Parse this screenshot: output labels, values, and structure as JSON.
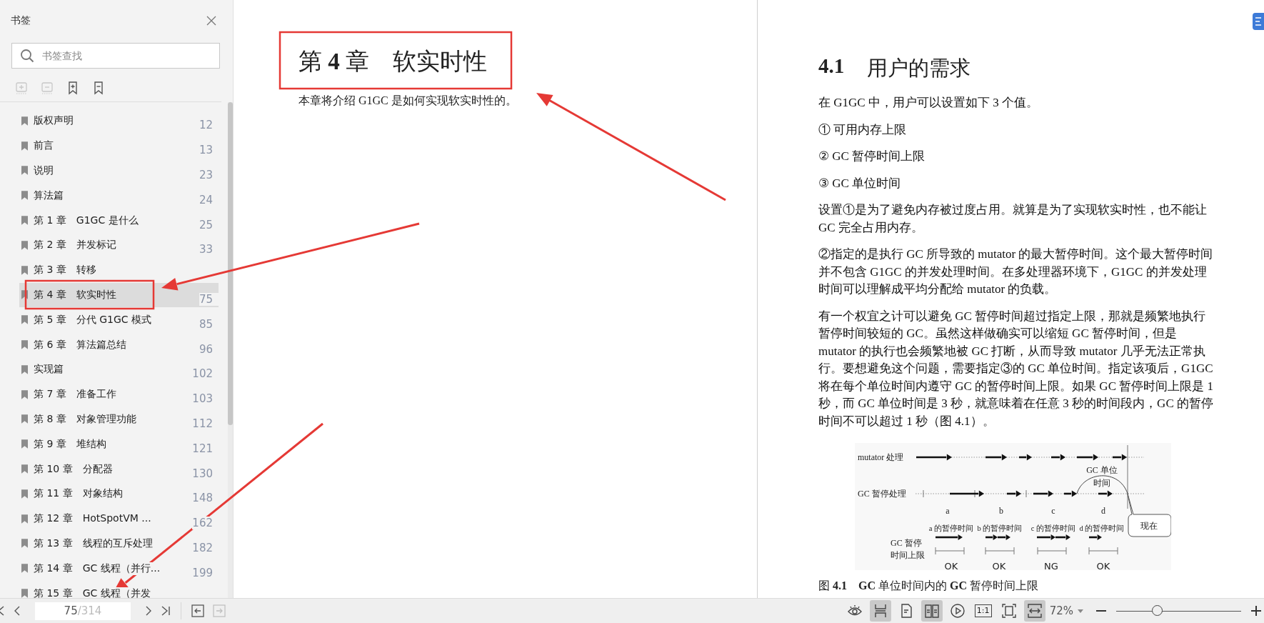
{
  "sidebar": {
    "title": "书签",
    "search": {
      "placeholder": "书签查找"
    },
    "tools": [
      {
        "kind": "expand",
        "disabled": true
      },
      {
        "kind": "collapse",
        "disabled": true
      },
      {
        "kind": "add",
        "disabled": false
      },
      {
        "kind": "remove",
        "disabled": false
      }
    ],
    "items": [
      {
        "label": "版权声明",
        "page": "12",
        "selected": false
      },
      {
        "label": "前言",
        "page": "13",
        "selected": false
      },
      {
        "label": "说明",
        "page": "23",
        "selected": false
      },
      {
        "label": "算法篇",
        "page": "24",
        "selected": false
      },
      {
        "label": "第 1 章　G1GC 是什么",
        "page": "25",
        "selected": false
      },
      {
        "label": "第 2 章　并发标记",
        "page": "33",
        "selected": false
      },
      {
        "label": "第 3 章　转移",
        "selected": false
      },
      {
        "label": "第 4 章　软实时性",
        "page": "75",
        "selected": true
      },
      {
        "label": "第 5 章　分代 G1GC 模式",
        "page": "85",
        "selected": false
      },
      {
        "label": "第 6 章　算法篇总结",
        "page": "96",
        "selected": false
      },
      {
        "label": "实现篇",
        "page": "102",
        "selected": false
      },
      {
        "label": "第 7 章　准备工作",
        "page": "103",
        "selected": false
      },
      {
        "label": "第 8 章　对象管理功能",
        "page": "112",
        "selected": false
      },
      {
        "label": "第 9 章　堆结构",
        "page": "121",
        "selected": false
      },
      {
        "label": "第 10 章　分配器",
        "page": "130",
        "selected": false
      },
      {
        "label": "第 11 章　对象结构",
        "page": "148",
        "selected": false
      },
      {
        "label": "第 12 章　HotSpotVM ...",
        "page": "162",
        "selected": false
      },
      {
        "label": "第 13 章　线程的互斥处理",
        "page": "182",
        "selected": false
      },
      {
        "label": "第 14 章　GC 线程（并行...",
        "page": "199",
        "selected": false
      },
      {
        "label": "第 15 章　GC 线程（并发",
        "selected": false
      }
    ]
  },
  "left_page": {
    "heading": "第 **4** 章　软实时性",
    "intro": "本章将介绍 G1GC 是如何实现软实时性的。"
  },
  "right_page": {
    "section_number": "4.1",
    "section_title": "用户的需求",
    "paragraphs": [
      "在 G1GC 中，用户可以设置如下 3 个值。",
      "① 可用内存上限",
      "② GC 暂停时间上限",
      "③ GC 单位时间",
      "设置①是为了避免内存被过度占用。就算是为了实现软实时性，也不能让 GC 完全占用内存。",
      "②指定的是执行 GC 所导致的 mutator 的最大暂停时间。这个最大暂停时间并不包含 G1GC 的并发处理时间。在多处理器环境下，G1GC 的并发处理时间可以理解成平均分配给 mutator 的负载。",
      "有一个权宜之计可以避免 GC 暂停时间超过指定上限，那就是频繁地执行暂停时间较短的 GC。虽然这样做确实可以缩短 GC 暂停时间，但是 mutator 的执行也会频繁地被 GC 打断，从而导致 mutator 几乎无法正常执行。要想避免这个问题，需要指定③的 GC 单位时间。指定该项后，G1GC 将在每个单位时间内遵守 GC 的暂停时间上限。如果 GC 暂停时间上限是 1 秒，而 GC 单位时间是 3 秒，就意味着在任意 3 秒的时间段内，GC 的暂停时间不可以超过 1 秒（图 4.1）。"
    ],
    "figure": {
      "rows": [
        "mutator 处理",
        "GC 暂停处理"
      ],
      "unit_label": [
        "GC 单位",
        "时间"
      ],
      "segments": [
        "a",
        "b",
        "c",
        "d"
      ],
      "pause_labels": [
        "a 的暂停时间",
        "b 的暂停时间",
        "c 的暂停时间",
        "d 的暂停时间"
      ],
      "limit_label": [
        "GC 暂停",
        "时间上限"
      ],
      "results": [
        "OK",
        "OK",
        "NG",
        "OK"
      ],
      "now_label": "现在"
    },
    "caption": "图 **4.1**　**GC** 单位时间内的 **GC** 暂停时间上限"
  },
  "toolbar": {
    "page_current": "75",
    "page_total": "/314",
    "panel_buttons": [
      {
        "kind": "back",
        "disabled": false
      },
      {
        "kind": "forward",
        "disabled": true
      }
    ],
    "view_buttons": [
      {
        "kind": "eye",
        "selected": false
      },
      {
        "kind": "continuous",
        "selected": true
      },
      {
        "kind": "single",
        "selected": false
      },
      {
        "kind": "double",
        "selected": true
      },
      {
        "kind": "play",
        "selected": false
      },
      {
        "kind": "actual",
        "label": "1:1",
        "selected": false
      },
      {
        "kind": "fit-page",
        "selected": false
      },
      {
        "kind": "fit-width",
        "selected": true
      }
    ],
    "zoom": "72%",
    "zoom_level": {
      "level": 0.33
    }
  }
}
